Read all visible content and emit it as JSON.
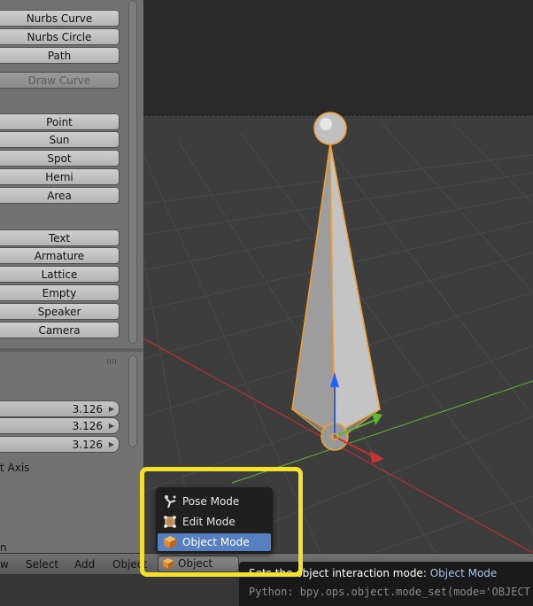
{
  "tool_panel": {
    "curve_buttons": [
      "Nurbs Curve",
      "Nurbs Circle",
      "Path"
    ],
    "draw_curve": "Draw Curve",
    "lamp_buttons": [
      "Point",
      "Sun",
      "Spot",
      "Hemi",
      "Area"
    ],
    "other_buttons": [
      "Text",
      "Armature",
      "Lattice",
      "Empty",
      "Speaker",
      "Camera"
    ],
    "values": [
      "3.126",
      "3.126",
      "3.126"
    ],
    "axis_label": "t Axis",
    "partial_label": "n"
  },
  "header": {
    "view": "w",
    "select": "Select",
    "add": "Add",
    "object": "Object",
    "mode": "Object Mode"
  },
  "mode_menu": {
    "items": [
      "Pose Mode",
      "Edit Mode",
      "Object Mode"
    ],
    "selected": "Object Mode"
  },
  "tooltip": {
    "description": "Sets the object interaction mode:",
    "value": "Object Mode",
    "python": "Python: bpy.ops.object.mode_set(mode='OBJECT')"
  },
  "colors": {
    "highlight": "#f5e02a",
    "selection": "#5680c2",
    "x_axis": "#c83232",
    "y_axis": "#5cb82e",
    "z_axis": "#2060ff",
    "outline": "#f0a030"
  }
}
